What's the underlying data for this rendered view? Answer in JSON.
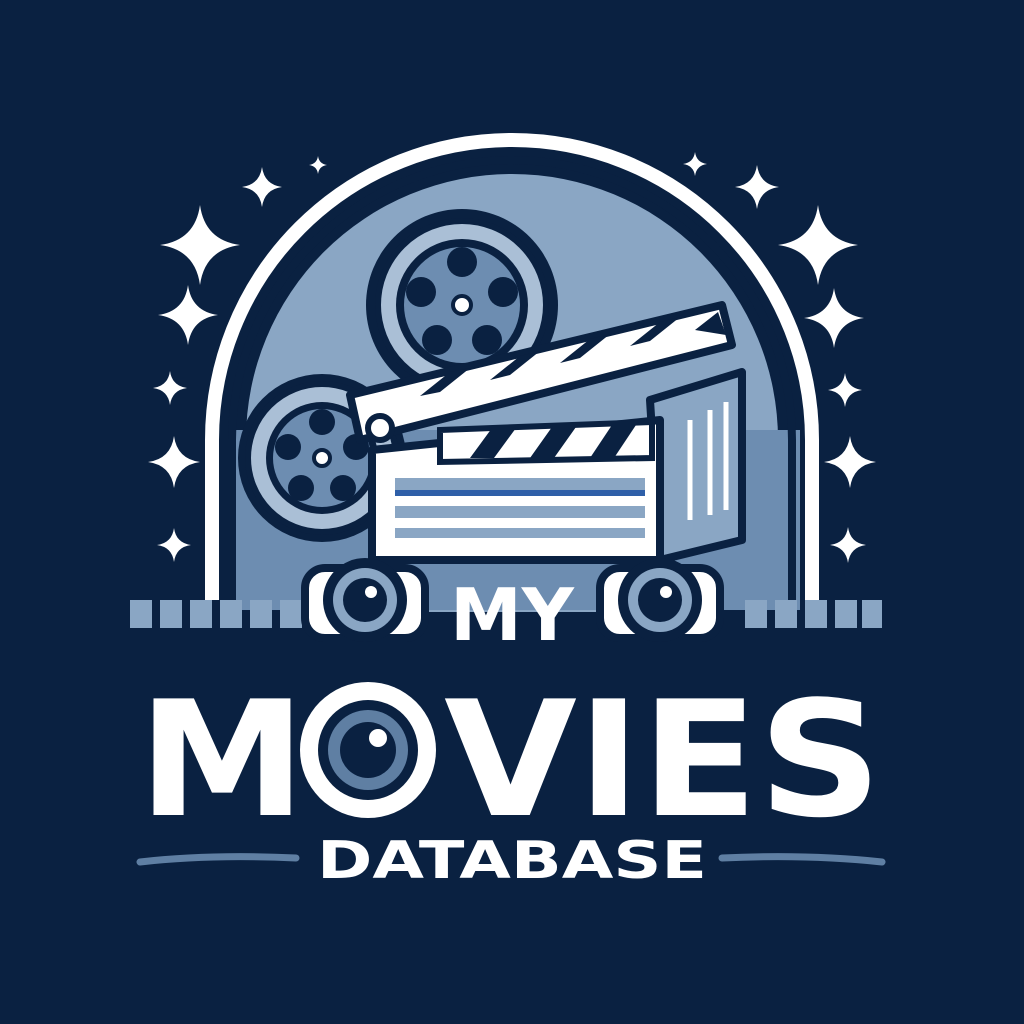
{
  "logo": {
    "word_top": "MY",
    "word_main": "MOVIES",
    "word_main_rest": "VIES",
    "word_sub": "DATABASE"
  },
  "colors": {
    "background": "#0a2141",
    "outline": "#0a2141",
    "accent_light": "#8aa6c4",
    "accent_mid": "#5f7fa3",
    "white": "#ffffff",
    "stripe_blue": "#2f5fa8"
  },
  "icons": [
    "sparkle-icon",
    "film-reel-icon",
    "clapperboard-icon",
    "camera-lens-icon"
  ]
}
